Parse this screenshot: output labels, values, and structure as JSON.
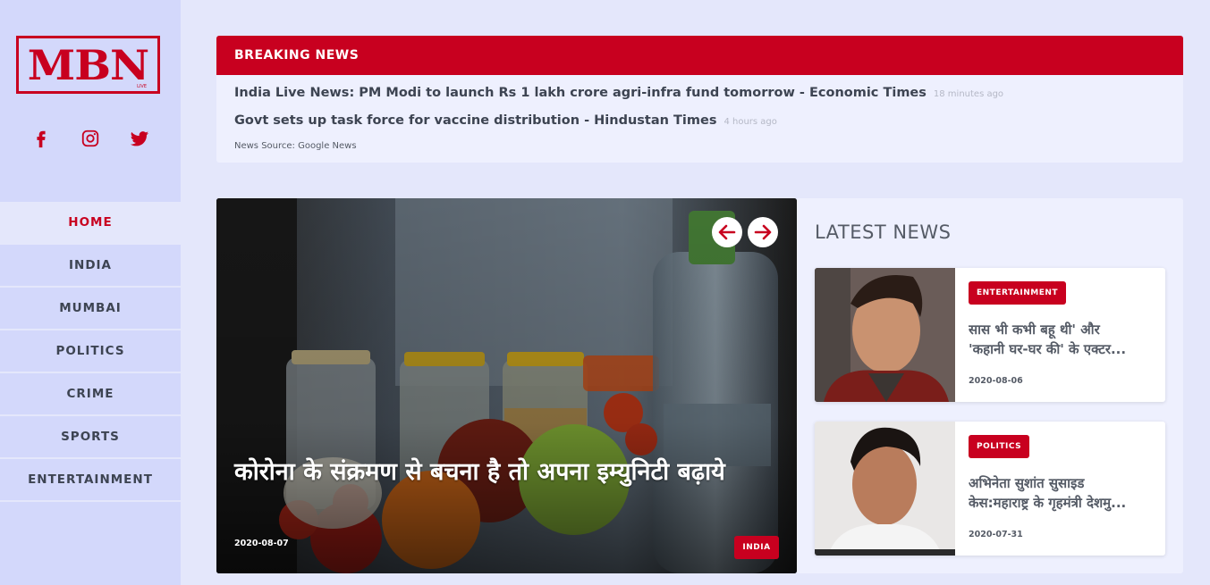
{
  "brand": {
    "logo_text": "MBN",
    "logo_sub": "LIVE",
    "accent_color": "#c8001f"
  },
  "socials": [
    {
      "icon": "facebook-icon"
    },
    {
      "icon": "instagram-icon"
    },
    {
      "icon": "twitter-icon"
    }
  ],
  "nav": {
    "items": [
      {
        "label": "HOME",
        "active": true
      },
      {
        "label": "INDIA"
      },
      {
        "label": "MUMBAI"
      },
      {
        "label": "POLITICS"
      },
      {
        "label": "CRIME"
      },
      {
        "label": "SPORTS"
      },
      {
        "label": "ENTERTAINMENT"
      }
    ]
  },
  "breaking": {
    "title": "BREAKING NEWS",
    "items": [
      {
        "headline": "India Live News: PM Modi to launch Rs 1 lakh crore agri-infra fund tomorrow - Economic Times",
        "ago": "18 minutes ago"
      },
      {
        "headline": "Govt sets up task force for vaccine distribution - Hindustan Times",
        "ago": "4 hours ago"
      }
    ],
    "source": "News Source: Google News"
  },
  "featured": {
    "title": "कोरोना के संक्रमण से बचना है तो अपना इम्युनिटी बढ़ाये",
    "date": "2020-08-07",
    "category": "INDIA"
  },
  "latest": {
    "title": "LATEST NEWS",
    "cards": [
      {
        "category": "ENTERTAINMENT",
        "title_line1": "सास भी कभी बहू थी' और",
        "title_line2": "'कहानी घर-घर की' के एक्टर...",
        "date": "2020-08-06"
      },
      {
        "category": "POLITICS",
        "title_line1": "अभिनेता सुशांत सुसाइड",
        "title_line2": "केस:महाराष्ट्र के गृहमंत्री देशमु...",
        "date": "2020-07-31"
      }
    ]
  }
}
